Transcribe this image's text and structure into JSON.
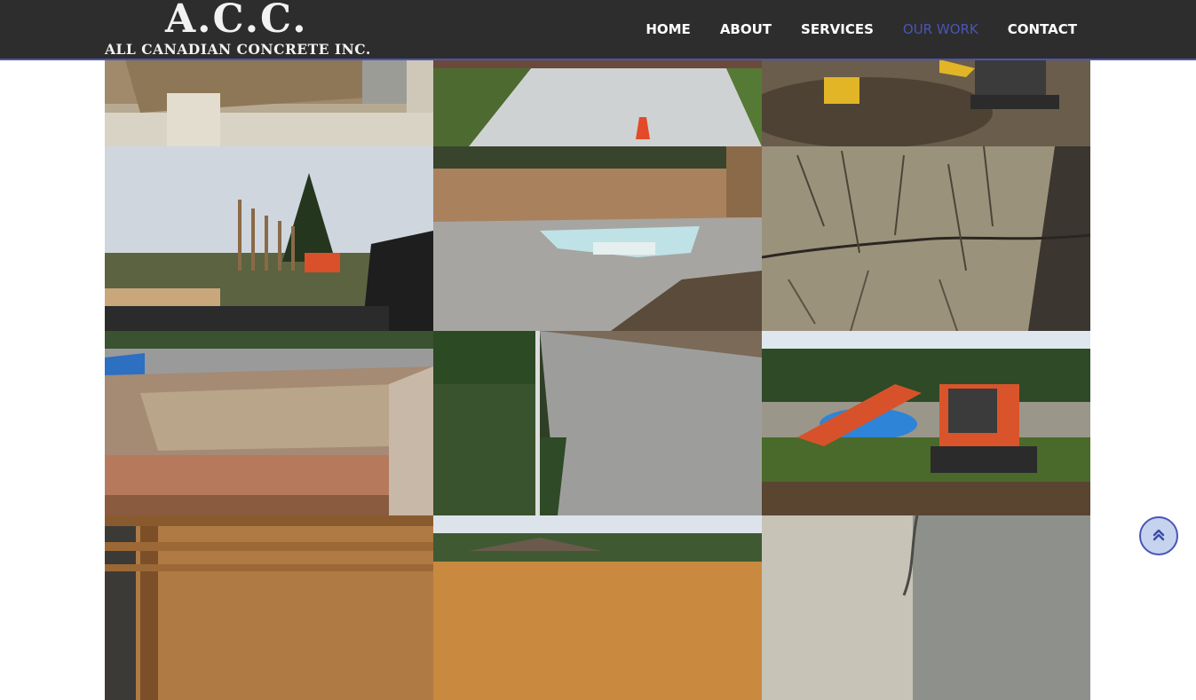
{
  "logo": {
    "mark": "A.C.C.",
    "name": "ALL CANADIAN CONCRETE INC."
  },
  "nav": {
    "items": [
      {
        "label": "HOME"
      },
      {
        "label": "ABOUT"
      },
      {
        "label": "SERVICES"
      },
      {
        "label": "OUR WORK",
        "active": true
      },
      {
        "label": "CONTACT"
      }
    ]
  },
  "colors": {
    "nav_bg": "#2d2d2d",
    "accent": "#4a55b5",
    "scroll_btn_bg": "#c6d3ef"
  },
  "gallery": {
    "photos": [
      {
        "subject": "block-foundation"
      },
      {
        "subject": "concrete-driveway"
      },
      {
        "subject": "excavator-site"
      },
      {
        "subject": "fence-posts-site"
      },
      {
        "subject": "stamped-pool-deck"
      },
      {
        "subject": "cracked-concrete"
      },
      {
        "subject": "wood-forms"
      },
      {
        "subject": "stamped-wall"
      },
      {
        "subject": "orange-excavator"
      },
      {
        "subject": "wood-framing"
      },
      {
        "subject": "backyard-fence"
      },
      {
        "subject": "concrete-crack-closeup"
      }
    ]
  },
  "scroll_top": {
    "icon": "double-chevron-up-icon"
  }
}
